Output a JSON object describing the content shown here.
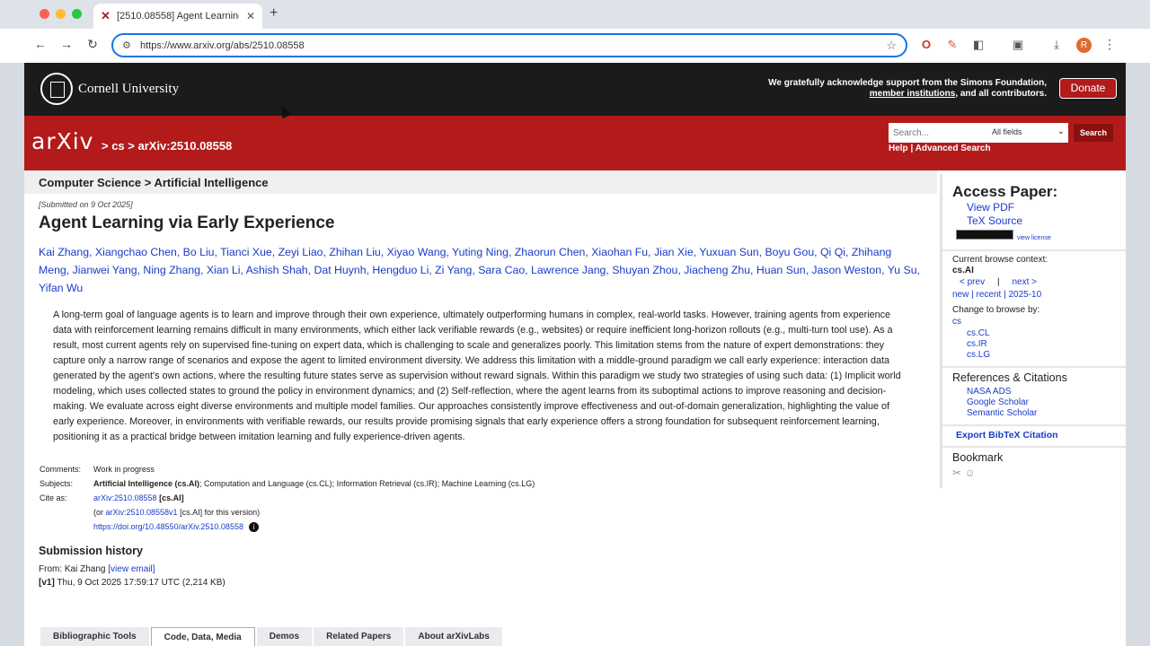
{
  "browser": {
    "tab_title": "[2510.08558] Agent Learning",
    "tab_favicon": "arxiv-x-icon",
    "url": "https://www.arxiv.org/abs/2510.08558",
    "profile_initial": "R",
    "icons": [
      "back-icon",
      "forward-icon",
      "reload-icon",
      "site-settings-icon",
      "bookmark-star-icon",
      "opera-icon",
      "pen-icon",
      "extensions-icon",
      "cast-icon",
      "download-icon",
      "menu-icon"
    ]
  },
  "cornell": {
    "name": "Cornell University",
    "ack_text": "We gratefully acknowledge support from the Simons Foundation,",
    "ack_link": "member institutions",
    "ack_end": ", and all contributors.",
    "donate": "Donate"
  },
  "arxiv_header": {
    "logo": "arXiv",
    "breadcrumb": "> cs > arXiv:2510.08558",
    "search_placeholder": "Search...",
    "field_select": "All fields",
    "search_button": "Search",
    "help_links": "Help | Advanced Search"
  },
  "paper": {
    "subject_header": "Computer Science > Artificial Intelligence",
    "submitted": "[Submitted on 9 Oct 2025]",
    "title": "Agent Learning via Early Experience",
    "authors": "Kai Zhang, Xiangchao Chen, Bo Liu, Tianci Xue, Zeyi Liao, Zhihan Liu, Xiyao Wang, Yuting Ning, Zhaorun Chen, Xiaohan Fu, Jian Xie, Yuxuan Sun, Boyu Gou, Qi Qi, Zhihang Meng, Jianwei Yang, Ning Zhang, Xian Li, Ashish Shah, Dat Huynh, Hengduo Li, Zi Yang, Sara Cao, Lawrence Jang, Shuyan Zhou, Jiacheng Zhu, Huan Sun, Jason Weston, Yu Su, Yifan Wu",
    "abstract": "A long-term goal of language agents is to learn and improve through their own experience, ultimately outperforming humans in complex, real-world tasks. However, training agents from experience data with reinforcement learning remains difficult in many environments, which either lack verifiable rewards (e.g., websites) or require inefficient long-horizon rollouts (e.g., multi-turn tool use). As a result, most current agents rely on supervised fine-tuning on expert data, which is challenging to scale and generalizes poorly. This limitation stems from the nature of expert demonstrations: they capture only a narrow range of scenarios and expose the agent to limited environment diversity. We address this limitation with a middle-ground paradigm we call early experience: interaction data generated by the agent's own actions, where the resulting future states serve as supervision without reward signals. Within this paradigm we study two strategies of using such data: (1) Implicit world modeling, which uses collected states to ground the policy in environment dynamics; and (2) Self-reflection, where the agent learns from its suboptimal actions to improve reasoning and decision-making. We evaluate across eight diverse environments and multiple model families. Our approaches consistently improve effectiveness and out-of-domain generalization, highlighting the value of early experience. Moreover, in environments with verifiable rewards, our results provide promising signals that early experience offers a strong foundation for subsequent reinforcement learning, positioning it as a practical bridge between imitation learning and fully experience-driven agents.",
    "comments_label": "Comments:",
    "comments": "Work in progress",
    "subjects_label": "Subjects:",
    "subjects_primary": "Artificial Intelligence (cs.AI)",
    "subjects_rest": "; Computation and Language (cs.CL); Information Retrieval (cs.IR); Machine Learning (cs.LG)",
    "cite_label": "Cite as:",
    "cite_id": "arXiv:2510.08558",
    "cite_tag": "[cs.AI]",
    "cite_v1_pre": "(or ",
    "cite_v1_id": "arXiv:2510.08558v1",
    "cite_v1_post": " [cs.AI] for this version)",
    "doi": "https://doi.org/10.48550/arXiv.2510.08558",
    "history_title": "Submission history",
    "from_text": "From: Kai Zhang ",
    "view_email": "[view email]",
    "v1_tag": "[v1]",
    "v1_text": " Thu, 9 Oct 2025 17:59:17 UTC (2,214 KB)"
  },
  "bottom_tabs": [
    "Bibliographic Tools",
    "Code, Data, Media",
    "Demos",
    "Related Papers",
    "About arXivLabs"
  ],
  "sidebar": {
    "access_title": "Access Paper:",
    "view_pdf": "View PDF",
    "tex_source": "TeX Source",
    "view_license": "view license",
    "context_label": "Current browse context:",
    "context": "cs.AI",
    "prev": "< prev",
    "sep": "|",
    "next": "next >",
    "nav2": "new | recent | 2025-10",
    "change_label": "Change to browse by:",
    "browse_cs": "cs",
    "browse_items": [
      "cs.CL",
      "cs.IR",
      "cs.LG"
    ],
    "refs_title": "References & Citations",
    "refs": [
      "NASA ADS",
      "Google Scholar",
      "Semantic Scholar"
    ],
    "export": "Export BibTeX Citation",
    "bookmark_title": "Bookmark"
  }
}
